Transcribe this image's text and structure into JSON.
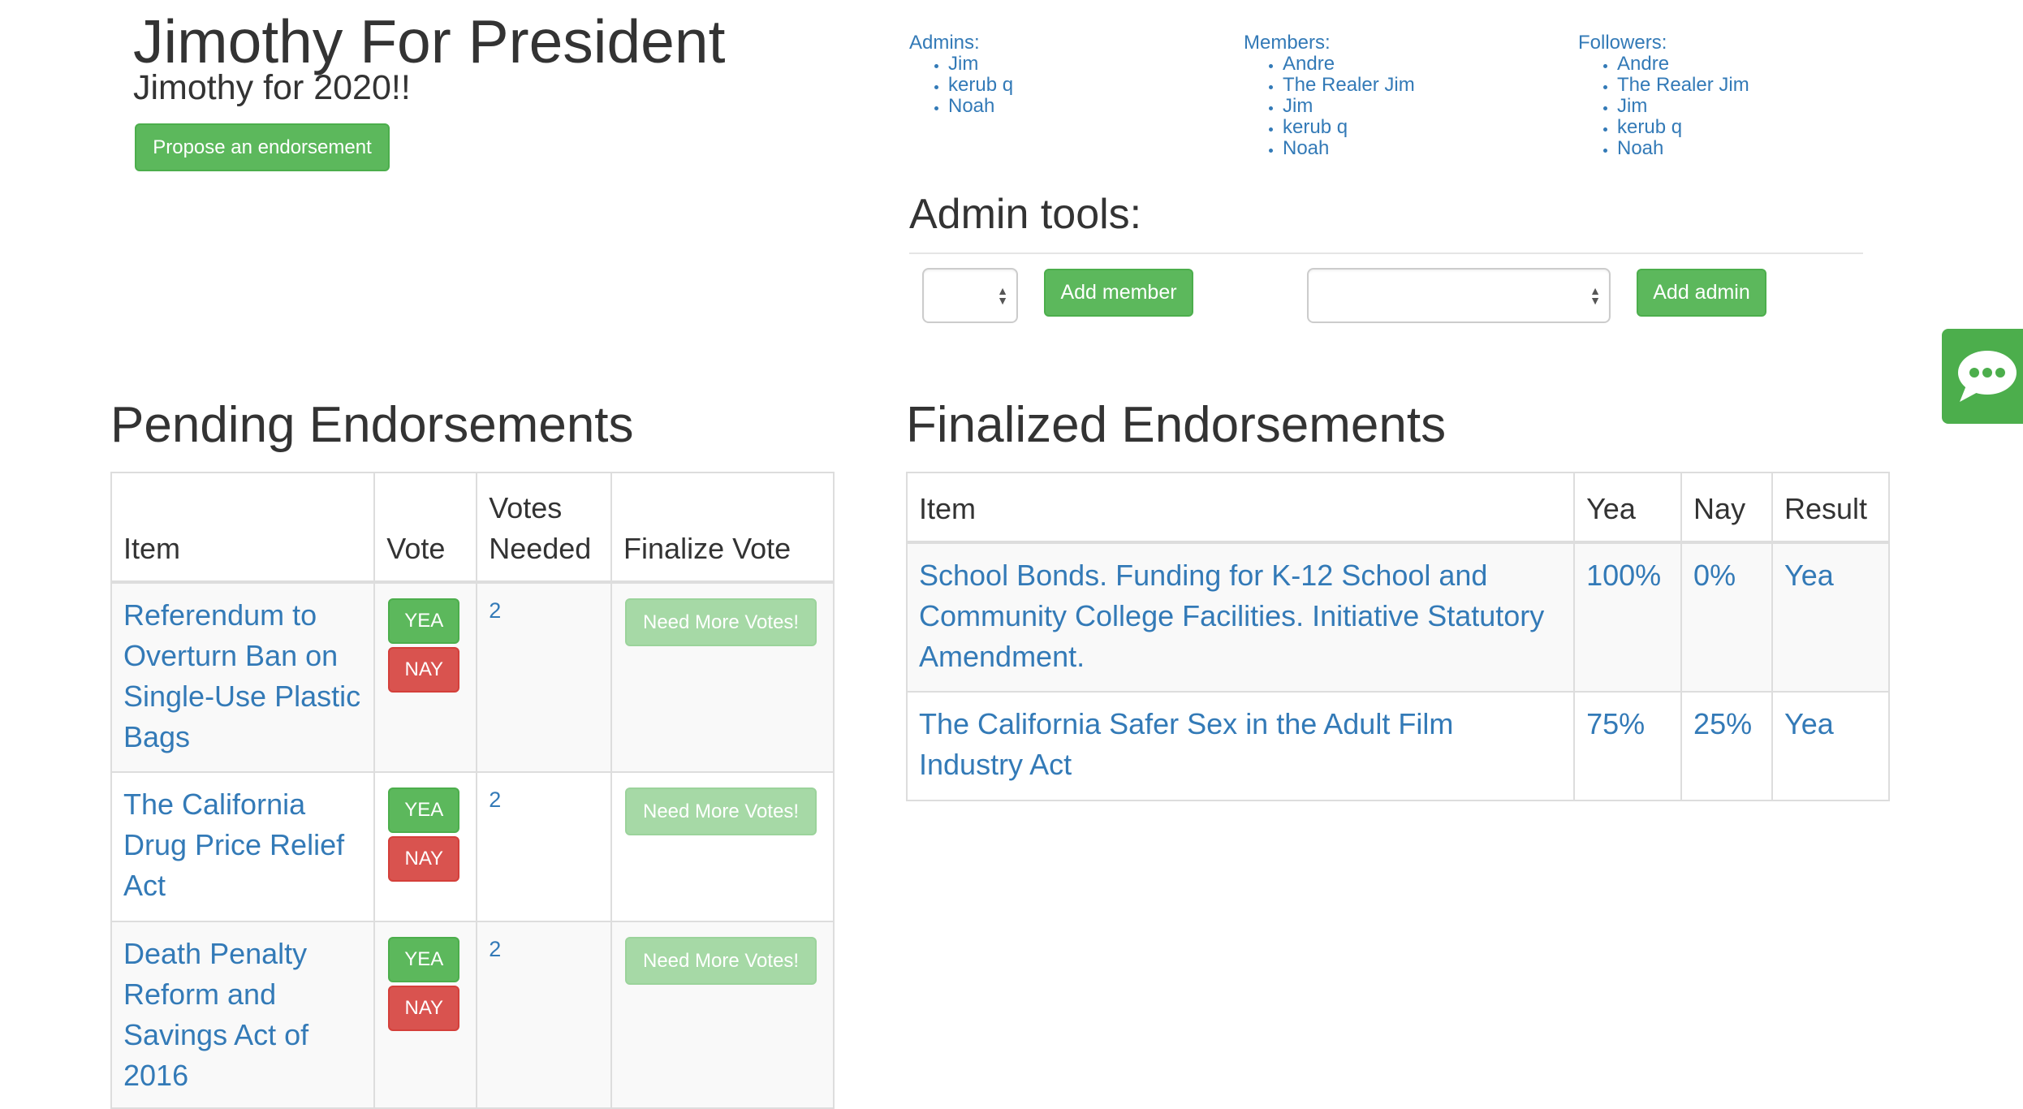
{
  "header": {
    "title": "Jimothy For President",
    "subtitle": "Jimothy for 2020!!",
    "propose_label": "Propose an endorsement"
  },
  "people": {
    "admins": {
      "label": "Admins:",
      "names": [
        "Jim",
        "kerub q",
        "Noah"
      ]
    },
    "members": {
      "label": "Members:",
      "names": [
        "Andre",
        "The Realer Jim",
        "Jim",
        "kerub q",
        "Noah"
      ]
    },
    "followers": {
      "label": "Followers:",
      "names": [
        "Andre",
        "The Realer Jim",
        "Jim",
        "kerub q",
        "Noah"
      ]
    }
  },
  "admin_tools": {
    "heading": "Admin tools:",
    "member_select_value": "",
    "add_member_label": "Add member",
    "admin_select_value": "",
    "add_admin_label": "Add admin"
  },
  "chat_widget": {
    "icon": "chat-bubble-icon"
  },
  "pending": {
    "heading": "Pending Endorsements",
    "columns": {
      "item": "Item",
      "vote": "Vote",
      "votes_needed": "Votes Needed",
      "finalize": "Finalize Vote"
    },
    "rows": [
      {
        "item": "Referendum to Overturn Ban on Single-Use Plastic Bags",
        "yea": "YEA",
        "nay": "NAY",
        "needed": "2",
        "finalize": "Need More Votes!"
      },
      {
        "item": "The California Drug Price Relief Act",
        "yea": "YEA",
        "nay": "NAY",
        "needed": "2",
        "finalize": "Need More Votes!"
      },
      {
        "item": "Death Penalty Reform and Savings Act of 2016",
        "yea": "YEA",
        "nay": "NAY",
        "needed": "2",
        "finalize": "Need More Votes!"
      }
    ]
  },
  "finalized": {
    "heading": "Finalized Endorsements",
    "columns": {
      "item": "Item",
      "yea": "Yea",
      "nay": "Nay",
      "result": "Result"
    },
    "rows": [
      {
        "item": "School Bonds. Funding for K-12 School and Community College Facilities. Initiative Statutory Amendment.",
        "yea": "100%",
        "nay": "0%",
        "result": "Yea"
      },
      {
        "item": "The California Safer Sex in the Adult Film Industry Act",
        "yea": "75%",
        "nay": "25%",
        "result": "Yea"
      }
    ]
  },
  "colors": {
    "link": "#337ab7",
    "success": "#5cb85c",
    "danger": "#d9534f",
    "disabled_success": "#a6d9a6"
  }
}
